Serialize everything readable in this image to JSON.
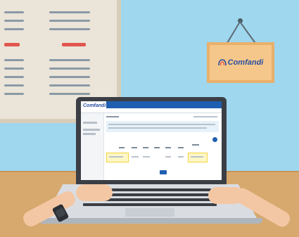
{
  "scene": {
    "colors": {
      "wall": "#9ed7ee",
      "desk": "#d7a96e",
      "board": "#ebe4d8",
      "board_accent": "#e1564e",
      "sign": "#f6c78b",
      "brand_blue": "#1f5fb0",
      "highlight": "#f2d43a"
    }
  },
  "sign": {
    "brand": "Comfandi",
    "icon": "comfandi-logo-icon"
  },
  "screen": {
    "logo_text": "Comfandi"
  }
}
